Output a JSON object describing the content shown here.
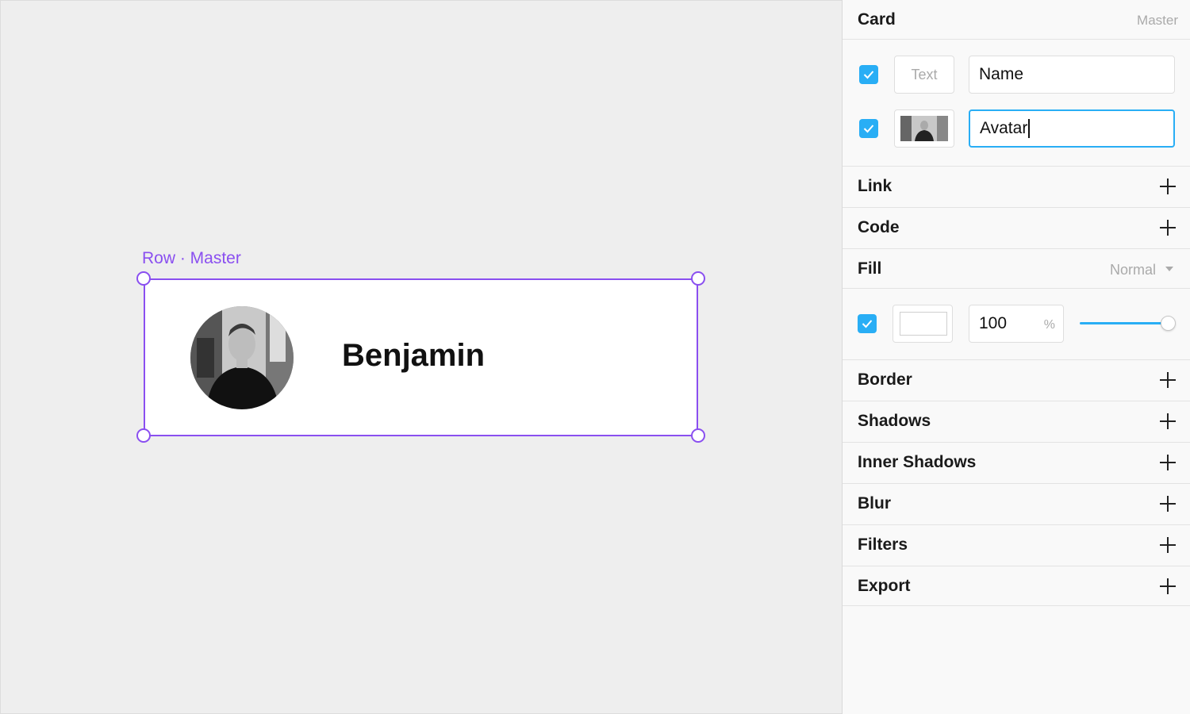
{
  "canvas": {
    "selection_label": "Row · Master",
    "card": {
      "name": "Benjamin"
    }
  },
  "panel": {
    "header": {
      "title": "Card",
      "badge": "Master"
    },
    "overrides": [
      {
        "checked": true,
        "type_label": "Text",
        "value": "Name"
      },
      {
        "checked": true,
        "type_label": "image",
        "value": "Avatar"
      }
    ],
    "sections": {
      "link": "Link",
      "code": "Code",
      "fill": "Fill",
      "border": "Border",
      "shadows": "Shadows",
      "inner_shadows": "Inner Shadows",
      "blur": "Blur",
      "filters": "Filters",
      "export": "Export"
    },
    "fill": {
      "blend_mode": "Normal",
      "checked": true,
      "color": "#ffffff",
      "opacity": "100",
      "opacity_unit": "%",
      "opacity_level": 1.0
    }
  },
  "colors": {
    "selection": "#8a4ff0",
    "accent": "#29aef5"
  }
}
